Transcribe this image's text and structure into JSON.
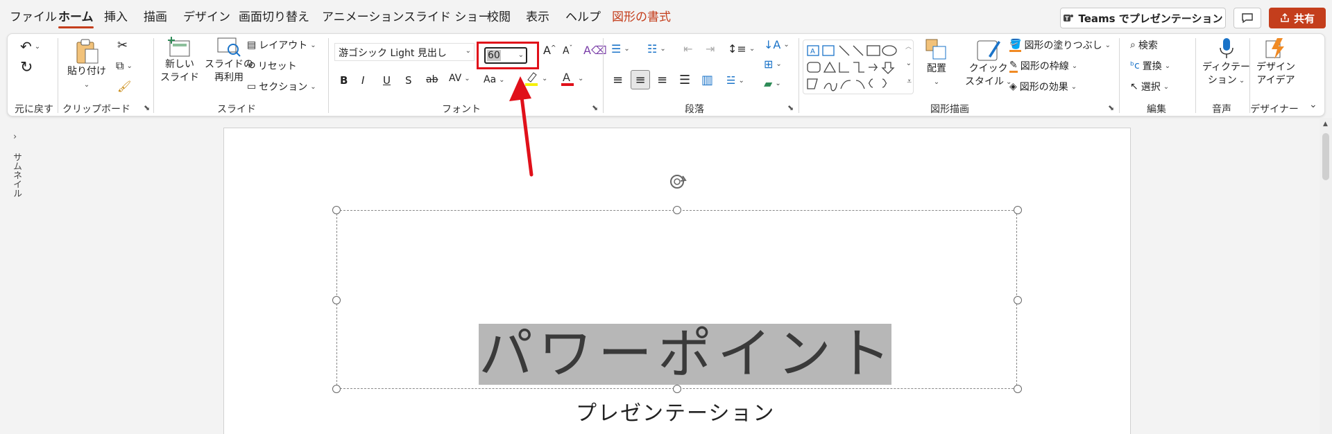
{
  "menu": {
    "items": [
      {
        "label": "ファイル"
      },
      {
        "label": "ホーム",
        "active": true
      },
      {
        "label": "挿入"
      },
      {
        "label": "描画"
      },
      {
        "label": "デザイン"
      },
      {
        "label": "画面切り替え"
      },
      {
        "label": "アニメーション"
      },
      {
        "label": "スライド ショー"
      },
      {
        "label": "校閲"
      },
      {
        "label": "表示"
      },
      {
        "label": "ヘルプ"
      },
      {
        "label": "図形の書式",
        "context": true
      }
    ],
    "teams_label": "Teams でプレゼンテーション",
    "share_label": "共有"
  },
  "ribbon": {
    "undo_group": "元に戻す",
    "clipboard": {
      "label": "クリップボード",
      "paste": "貼り付け"
    },
    "slides": {
      "label": "スライド",
      "new_slide_1": "新しい",
      "new_slide_2": "スライド",
      "reuse_1": "スライドの",
      "reuse_2": "再利用",
      "layout": "レイアウト",
      "reset": "リセット",
      "section": "セクション"
    },
    "font": {
      "label": "フォント",
      "name": "游ゴシック Light 見出し",
      "size": "60",
      "bold": "B",
      "italic": "I",
      "underline": "U",
      "shadow": "S",
      "strike": "ab",
      "spacing": "AV",
      "case": "Aa"
    },
    "paragraph": {
      "label": "段落"
    },
    "drawing": {
      "label": "図形描画",
      "arrange": "配置",
      "quick_style_1": "クイック",
      "quick_style_2": "スタイル",
      "fill": "図形の塗りつぶし",
      "outline": "図形の枠線",
      "effects": "図形の効果"
    },
    "editing": {
      "label": "編集",
      "find": "検索",
      "replace": "置換",
      "select": "選択"
    },
    "voice": {
      "label": "音声",
      "dictate_1": "ディクテー",
      "dictate_2": "ション"
    },
    "designer": {
      "label": "デザイナー",
      "ideas_1": "デザイン",
      "ideas_2": "アイデア"
    }
  },
  "pane": {
    "thumbnail": "サムネイル"
  },
  "slide": {
    "title": "パワーポイント",
    "subtitle": "プレゼンテーション"
  },
  "colors": {
    "accent": "#c43e1c",
    "highlight": "#e0101a"
  }
}
